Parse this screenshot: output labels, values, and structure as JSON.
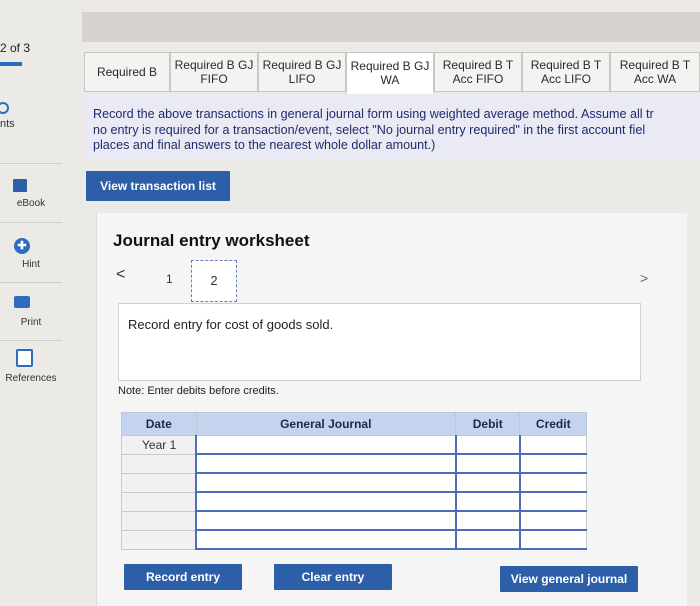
{
  "sidebar": {
    "question_counter": "2 of 3",
    "points_label": "nts",
    "items": [
      {
        "label": "eBook"
      },
      {
        "label": "Hint"
      },
      {
        "label": "Print"
      },
      {
        "label": "References"
      }
    ]
  },
  "tabs": [
    {
      "label": "Required B"
    },
    {
      "label": "Required B GJ FIFO"
    },
    {
      "label": "Required B GJ LIFO"
    },
    {
      "label": "Required B GJ WA"
    },
    {
      "label": "Required B T Acc FIFO"
    },
    {
      "label": "Required B T Acc LIFO"
    },
    {
      "label": "Required B T Acc WA"
    }
  ],
  "instruction": {
    "line1": "Record the above transactions in general journal form using weighted average method. Assume all tr",
    "line2": "no entry is required for a transaction/event, select \"No journal entry required\" in the first account fiel",
    "line3": "places and final answers to the nearest whole dollar amount.)"
  },
  "buttons": {
    "view_transactions": "View transaction list",
    "record_entry": "Record entry",
    "clear_entry": "Clear entry",
    "view_journal": "View general journal"
  },
  "worksheet": {
    "title": "Journal entry worksheet",
    "page_prev": "<",
    "page_next": ">",
    "page1": "1",
    "page2": "2",
    "entry_description": "Record entry for cost of goods sold.",
    "note": "Note: Enter debits before credits."
  },
  "journal": {
    "headers": {
      "date": "Date",
      "general_journal": "General Journal",
      "debit": "Debit",
      "credit": "Credit"
    },
    "first_date": "Year 1"
  },
  "colors": {
    "accent": "#2d5fa8",
    "table_header": "#c4d4ee",
    "instruction_bg": "#eaeaf4"
  }
}
